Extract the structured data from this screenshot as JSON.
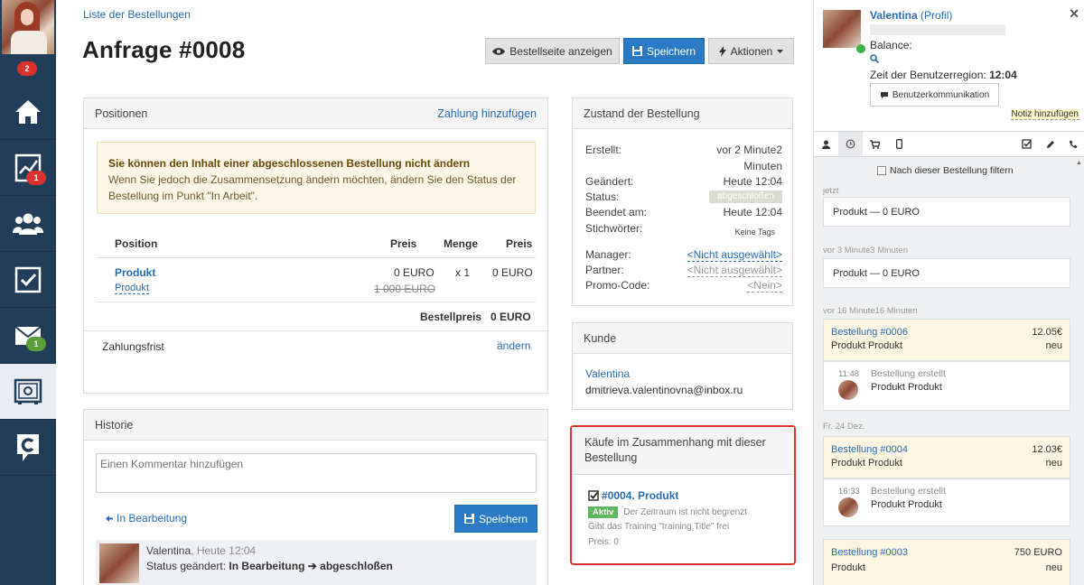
{
  "nav": {
    "badges": {
      "avatar": "2",
      "stats": "1",
      "mail": "1"
    }
  },
  "header": {
    "back_link": "Liste der Bestellungen",
    "title": "Anfrage #0008",
    "btn_view": "Bestellseite anzeigen",
    "btn_save": "Speichern",
    "btn_actions": "Aktionen"
  },
  "positions": {
    "title": "Positionen",
    "add_payment": "Zahlung hinzufügen",
    "warning_title": "Sie können den Inhalt einer abgeschlossenen Bestellung nicht ändern",
    "warning_text": "Wenn Sie jedoch die Zusammensetzung ändern möchten, ändern Sie den Status der Bestellung im Punkt \"In Arbeit\".",
    "headers": {
      "position": "Position",
      "preis": "Preis",
      "menge": "Menge",
      "preis2": "Preis"
    },
    "row": {
      "name": "Produkt",
      "sub": "Produkt",
      "price": "0 EURO",
      "old_price": "1 000 EURO",
      "qty": "x 1",
      "total": "0 EURO"
    },
    "order_price_label": "Bestellpreis",
    "order_price": "0 EURO",
    "deadline_label": "Zahlungsfrist",
    "deadline_change": "ändern"
  },
  "history": {
    "title": "Historie",
    "comment_placeholder": "Einen Kommentar hinzufügen",
    "back_status": "In Bearbeitung",
    "save": "Speichern",
    "entry_author": "Valentina",
    "entry_time": ", Heute 12:04",
    "entry_status_label": "Status geändert: ",
    "entry_from": "In Bearbeitung",
    "entry_to": "abgeschloßen"
  },
  "state": {
    "title": "Zustand der Bestellung",
    "rows": [
      {
        "label": "Erstellt:",
        "value": "vor 2 Minute2"
      },
      {
        "label": "",
        "value": "Minuten"
      },
      {
        "label": "Geändert:",
        "value": "Heute 12:04"
      },
      {
        "label": "Status:",
        "value": "abgeschloßen"
      },
      {
        "label": "Beendet am:",
        "value": "Heute 12:04"
      },
      {
        "label": "Stichwörter:",
        "value": "Keine Tags"
      },
      {
        "label": "Manager:",
        "value": "<Nicht ausgewählt>"
      },
      {
        "label": "Partner:",
        "value": "<Nicht ausgewählt>"
      },
      {
        "label": "Promo-Code:",
        "value": "<Nein>"
      }
    ]
  },
  "customer": {
    "title": "Kunde",
    "name": "Valentina",
    "email": "dmitrieva.valentinovna@inbox.ru"
  },
  "related": {
    "title": "Käufe im Zusammenhang mit dieser Bestellung",
    "item_title": "#0004. Produkt",
    "badge": "Aktiv",
    "period": "Der Zeitraum ist nicht begrenzt",
    "desc": "Gibt das Training \"training Title\" frei",
    "price": "Preis: 0"
  },
  "sidebar": {
    "name": "Valentina",
    "profile": "(Profil)",
    "balance": "Balance:",
    "timezone_label": "Zeit der Benutzerregion: ",
    "timezone_value": "12:04",
    "comm_button": "Benutzerkommunikation",
    "add_note": "Notiz hinzufügen",
    "filter": "Nach dieser Bestellung filtern",
    "groups": [
      {
        "date": "jetzt",
        "title": "Produkt — 0 EURO"
      },
      {
        "date": "vor 3 Minute3 Minuten",
        "title": "Produkt — 0 EURO"
      },
      {
        "date": "vor 16 Minute16 Minuten",
        "order": "Bestellung #0006",
        "amount": "12.05€",
        "product": "Produkt Produkt",
        "status": "neu",
        "time": "11:48",
        "event": "Bestellung erstellt",
        "event_product": "Produkt Produkt"
      },
      {
        "date": "Fr. 24 Dez.",
        "order": "Bestellung #0004",
        "amount": "12.03€",
        "product": "Produkt Produkt",
        "status": "neu",
        "time": "16:33",
        "event": "Bestellung erstellt",
        "event_product": "Produkt Produkt"
      },
      {
        "order": "Bestellung #0003",
        "amount": "750 EURO",
        "product": "Produkt",
        "status": "neu"
      }
    ]
  },
  "colors": {
    "nav_bg": "#223d5a",
    "accent": "#2a7bc4",
    "highlight_border": "#d9322c",
    "status_active": "#5cb85c"
  }
}
